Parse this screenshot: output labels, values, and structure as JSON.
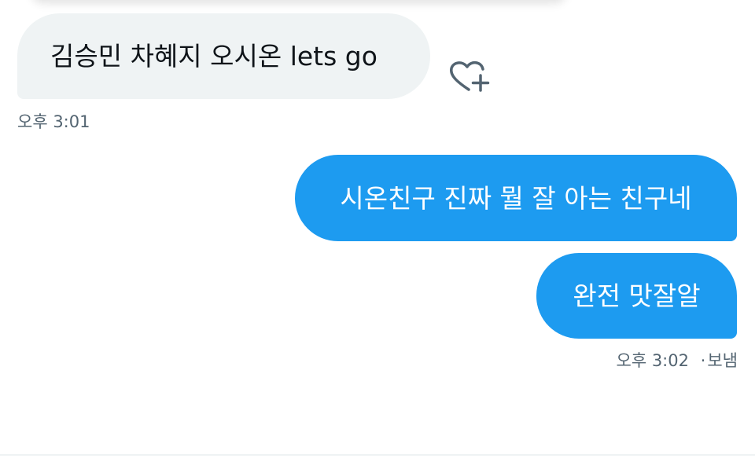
{
  "messages": [
    {
      "direction": "received",
      "text": "김승민 차혜지 오시온 lets go"
    },
    {
      "direction": "sent",
      "text": "시온친구 진짜 뭘 잘 아는 친구네"
    },
    {
      "direction": "sent",
      "text": "완전 맛잘알"
    }
  ],
  "received_timestamp": "오후 3:01",
  "sent_status": {
    "time": "오후 3:02",
    "separator": "·",
    "status": "보냄"
  },
  "colors": {
    "sent_bubble": "#1d9bf0",
    "received_bubble": "#eff3f4",
    "secondary_text": "#536471",
    "icon": "#536471"
  },
  "icons": {
    "reaction": "heart-plus-icon"
  }
}
